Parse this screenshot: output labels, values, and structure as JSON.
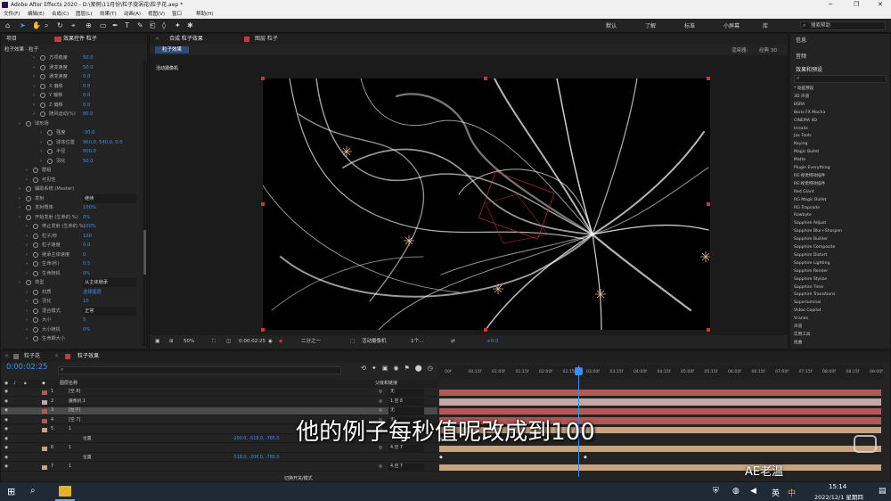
{
  "app": {
    "title": "Adobe After Effects 2020 - D:\\案例\\11月份\\粒子旋涡花\\粒子花.aep *"
  },
  "menu": [
    "文件(F)",
    "编辑(E)",
    "合成(C)",
    "图层(L)",
    "效果(T)",
    "动画(A)",
    "视图(V)",
    "窗口",
    "帮助(H)"
  ],
  "workspaces": [
    "默认",
    "了解",
    "标准",
    "小屏幕",
    "库"
  ],
  "search": {
    "placeholder": "搜索帮助"
  },
  "effects_panel": {
    "tabs": [
      "项目",
      "效果控件 粒子"
    ],
    "breadcrumb": "粒子效果 · 粒子",
    "rows": [
      {
        "label": "方项稳度",
        "value": "50.0"
      },
      {
        "label": "通变速度",
        "value": "50.0"
      },
      {
        "label": "通变速度",
        "value": "0.0"
      },
      {
        "label": "X 偏移",
        "value": "0.0"
      },
      {
        "label": "Y 偏移",
        "value": "0.0"
      },
      {
        "label": "Z 偏移",
        "value": "0.0"
      },
      {
        "label": "随风运动(%)",
        "value": "80.0"
      },
      {
        "label": "球形场",
        "value": ""
      },
      {
        "label": "强度",
        "value": "-30.0"
      },
      {
        "label": "球体位置",
        "value": "960.0, 540.0, 0.0"
      },
      {
        "label": "半径",
        "value": "800.0"
      },
      {
        "label": "羽化",
        "value": "50.0"
      },
      {
        "label": "群组",
        "value": ""
      },
      {
        "label": "可见性",
        "value": ""
      },
      {
        "label": "辅助系统 (Master)",
        "value": ""
      },
      {
        "label": "发射",
        "value": "继续"
      },
      {
        "label": "发射概率",
        "value": "100%"
      },
      {
        "label": "开始发射 (生命的 %)",
        "value": "0%"
      },
      {
        "label": "停止发射 (生命的 %)",
        "value": "100%"
      },
      {
        "label": "粒子/秒",
        "value": "100"
      },
      {
        "label": "粒子速度",
        "value": "0.0"
      },
      {
        "label": "继承主体速度",
        "value": "0"
      },
      {
        "label": "生命(秒)",
        "value": "0.5"
      },
      {
        "label": "生命随机",
        "value": "0%"
      },
      {
        "label": "类型",
        "value": "从主体继承"
      },
      {
        "label": "材质",
        "value": "选择图层"
      },
      {
        "label": "羽化",
        "value": "10"
      },
      {
        "label": "混合模式",
        "value": "正常"
      },
      {
        "label": "大小",
        "value": "5"
      },
      {
        "label": "大小随机",
        "value": "0%"
      },
      {
        "label": "生命期大小",
        "value": ""
      }
    ]
  },
  "comp_panel": {
    "tabs": [
      "合成 粒子效果",
      "图层 粒子"
    ],
    "subtab": "粒子效果",
    "renderer_label": "渲染器:",
    "renderer_value": "经典 3D",
    "camera_label": "活动摄像机",
    "footer": {
      "zoom": "50%",
      "time": "0:00:02:25",
      "resolution": "二分之一",
      "view": "活动摄像机",
      "views": "1个...",
      "exposure": "+0.0"
    }
  },
  "right_panel": {
    "tabs": [
      "信息",
      "音频",
      "效果和预设"
    ],
    "search_placeholder": "",
    "items": [
      "* 动画预设",
      "3D 声道",
      "BSRA",
      "Boris FX Mocha",
      "CINEMA 4D",
      "Irrealix",
      "Jax Tools",
      "Keying",
      "Magic Bullet",
      "Matte",
      "Plugin Everything",
      "RE:视觉特效插件",
      "RE:视觉特效插件",
      "Red Giant",
      "RG Magic Bullet",
      "RG Trapcode",
      "Rowbyte",
      "Sapphire Adjust",
      "Sapphire Blur+Sharpen",
      "Sapphire Builder",
      "Sapphire Composite",
      "Sapphire Distort",
      "Sapphire Lighting",
      "Sapphire Render",
      "Sapphire Stylize",
      "Sapphire Time",
      "Sapphire Transitions",
      "Superluminal",
      "Video Copilot",
      "Vranos",
      "声道",
      "实用工具",
      "扭曲"
    ]
  },
  "timeline": {
    "tabs": [
      "粒子花",
      "粒子效果"
    ],
    "timecode": "0:00:02:25",
    "search_placeholder": "",
    "col_layer_name": "图层名称",
    "col_parent": "父级和链接",
    "footer": "切换开关/模式",
    "ruler": [
      "00f",
      "00:15f",
      "01:00f",
      "01:15f",
      "02:00f",
      "02:15f",
      "03:00f",
      "03:15f",
      "04:00f",
      "04:15f",
      "05:00f",
      "05:15f",
      "06:00f",
      "06:15f",
      "07:00f",
      "07:15f",
      "08:00f",
      "08:15f",
      "09:00f"
    ],
    "layers": [
      {
        "num": "1",
        "name": "[空 8]",
        "parent": "无",
        "color": "#b15959"
      },
      {
        "num": "2",
        "name": "摄像机 1",
        "parent": "1.空 8",
        "color": "#c5a7a7"
      },
      {
        "num": "3",
        "name": "[粒子]",
        "parent": "无",
        "color": "#b15959"
      },
      {
        "num": "4",
        "name": "[空 7]",
        "parent": "无",
        "color": "#b15959"
      },
      {
        "num": "5",
        "name": "1",
        "parent": "4.空 7",
        "color": "#c7a37e"
      },
      {
        "num": "",
        "name": "位置",
        "value": "-200.0, -518.0, -765.0",
        "parent": "",
        "color": ""
      },
      {
        "num": "6",
        "name": "1",
        "parent": "4.空 7",
        "color": "#c7a37e"
      },
      {
        "num": "",
        "name": "位置",
        "value": "-518.0, -200.0, -765.0",
        "parent": "",
        "color": ""
      },
      {
        "num": "7",
        "name": "1",
        "parent": "4.空 7",
        "color": "#c7a37e"
      }
    ]
  },
  "subtitle": "他的例子每秒值呢改成到100",
  "watermark": "AE老温",
  "taskbar": {
    "time": "15:14",
    "date": "2022/12/1 星期四",
    "ime": "英",
    "lang_icon": "中"
  }
}
